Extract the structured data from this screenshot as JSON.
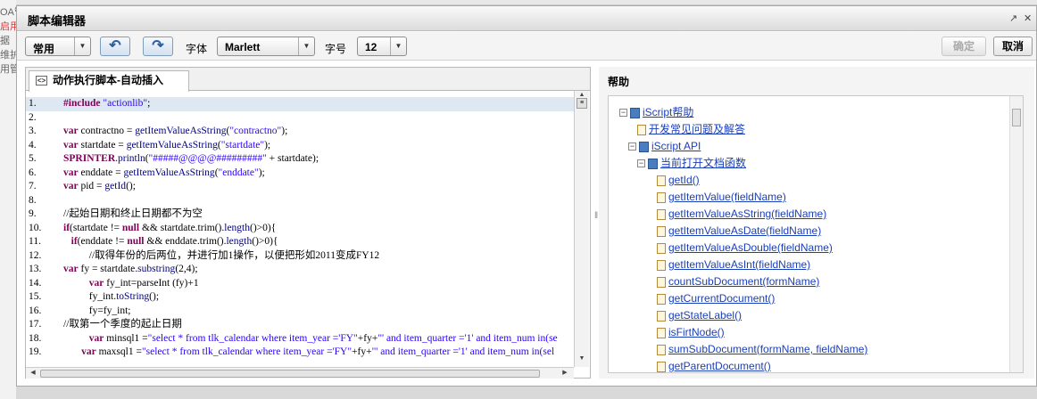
{
  "window": {
    "title": "脚本编辑器",
    "restore_icon": "↗",
    "close_icon": "✕"
  },
  "toolbar": {
    "mode_value": "常用",
    "undo_icon": "undo-icon",
    "redo_icon": "redo-icon",
    "font_label": "字体",
    "font_value": "Marlett",
    "size_label": "字号",
    "size_value": "12",
    "confirm_label": "确定",
    "cancel_label": "取消"
  },
  "editor": {
    "tab_label": "动作执行脚本-自动插入",
    "lines": [
      {
        "n": "1.",
        "html": "<span class=\"kw\">#include</span> <span class=\"st\">\"actionlib\"</span>;"
      },
      {
        "n": "2.",
        "html": ""
      },
      {
        "n": "3.",
        "html": "<span class=\"kw\">var</span> contractno = <span class=\"fn\">getItemValueAsString</span>(<span class=\"st\">\"contractno\"</span>);"
      },
      {
        "n": "4.",
        "html": "<span class=\"kw\">var</span> startdate = <span class=\"fn\">getItemValueAsString</span>(<span class=\"st\">\"startdate\"</span>);"
      },
      {
        "n": "5.",
        "html": "<span class=\"kw\">SPRINTER</span>.<span class=\"fn\">println</span>(<span class=\"st\">\"#####@@@@#########\"</span> + startdate);"
      },
      {
        "n": "6.",
        "html": "<span class=\"kw\">var</span> enddate = <span class=\"fn\">getItemValueAsString</span>(<span class=\"st\">\"enddate\"</span>);"
      },
      {
        "n": "7.",
        "html": "<span class=\"kw\">var</span> pid = <span class=\"fn\">getId</span>();"
      },
      {
        "n": "8.",
        "html": ""
      },
      {
        "n": "9.",
        "html": "//起始日期和终止日期都不为空"
      },
      {
        "n": "10.",
        "html": "<span class=\"kw\">if</span>(startdate != <span class=\"kw\">null</span> &amp;&amp; startdate.trim().<span class=\"fn\">length</span>()&gt;0){"
      },
      {
        "n": "11.",
        "html": "   <span class=\"kw\">if</span>(enddate != <span class=\"kw\">null</span> &amp;&amp; enddate.trim().<span class=\"fn\">length</span>()&gt;0){"
      },
      {
        "n": "12.",
        "html": "          //取得年份的后两位，并进行加1操作，以便把形如2011变成FY12"
      },
      {
        "n": "13.",
        "html": "<span class=\"kw\">var</span> fy = startdate.<span class=\"fn\">substring</span>(2,4);"
      },
      {
        "n": "14.",
        "html": "          <span class=\"kw\">var</span> fy_int=parseInt (fy)+1"
      },
      {
        "n": "15.",
        "html": "          fy_int.<span class=\"fn\">toString</span>();"
      },
      {
        "n": "16.",
        "html": "          fy=fy_int;"
      },
      {
        "n": "17.",
        "html": "//取第一个季度的起止日期"
      },
      {
        "n": "18.",
        "html": "          <span class=\"kw\">var</span> minsql1 =<span class=\"st\">\"select * from tlk_calendar where item_year ='FY\"</span>+fy+<span class=\"st\">\"' and item_quarter ='1' and item_num in(se</span>"
      },
      {
        "n": "19.",
        "html": "       <span class=\"kw\">var</span> maxsql1 =<span class=\"st\">\"select * from tlk_calendar where item_year ='FY\"</span>+fy+<span class=\"st\">\"' and item_quarter ='1' and item_num in(sel</span>"
      }
    ]
  },
  "help": {
    "title": "帮助",
    "nodes": [
      {
        "label": "iScript帮助",
        "level": 0,
        "kind": "book",
        "toggle": "−"
      },
      {
        "label": "开发常见问题及解答",
        "level": 1,
        "kind": "doc",
        "toggle": ""
      },
      {
        "label": "iScript API",
        "level": 1,
        "kind": "book",
        "toggle": "−"
      },
      {
        "label": "当前打开文档函数",
        "level": 2,
        "kind": "book",
        "toggle": "−"
      },
      {
        "label": "getId()",
        "level": 3,
        "kind": "doc",
        "toggle": ""
      },
      {
        "label": "getItemValue(fieldName)",
        "level": 3,
        "kind": "doc",
        "toggle": ""
      },
      {
        "label": "getItemValueAsString(fieldName)",
        "level": 3,
        "kind": "doc",
        "toggle": ""
      },
      {
        "label": "getItemValueAsDate(fieldName)",
        "level": 3,
        "kind": "doc",
        "toggle": ""
      },
      {
        "label": "getItemValueAsDouble(fieldName)",
        "level": 3,
        "kind": "doc",
        "toggle": ""
      },
      {
        "label": "getItemValueAsInt(fieldName)",
        "level": 3,
        "kind": "doc",
        "toggle": ""
      },
      {
        "label": "countSubDocument(formName)",
        "level": 3,
        "kind": "doc",
        "toggle": ""
      },
      {
        "label": "getCurrentDocument()",
        "level": 3,
        "kind": "doc",
        "toggle": ""
      },
      {
        "label": "getStateLabel()",
        "level": 3,
        "kind": "doc",
        "toggle": ""
      },
      {
        "label": "isFirtNode()",
        "level": 3,
        "kind": "doc",
        "toggle": ""
      },
      {
        "label": "sumSubDocument(formName, fieldName)",
        "level": 3,
        "kind": "doc",
        "toggle": ""
      },
      {
        "label": "getParentDocument()",
        "level": 3,
        "kind": "doc",
        "toggle": ""
      }
    ]
  },
  "background": {
    "side_text": [
      "OA管",
      "启用",
      "据",
      "维护",
      "用管"
    ]
  }
}
